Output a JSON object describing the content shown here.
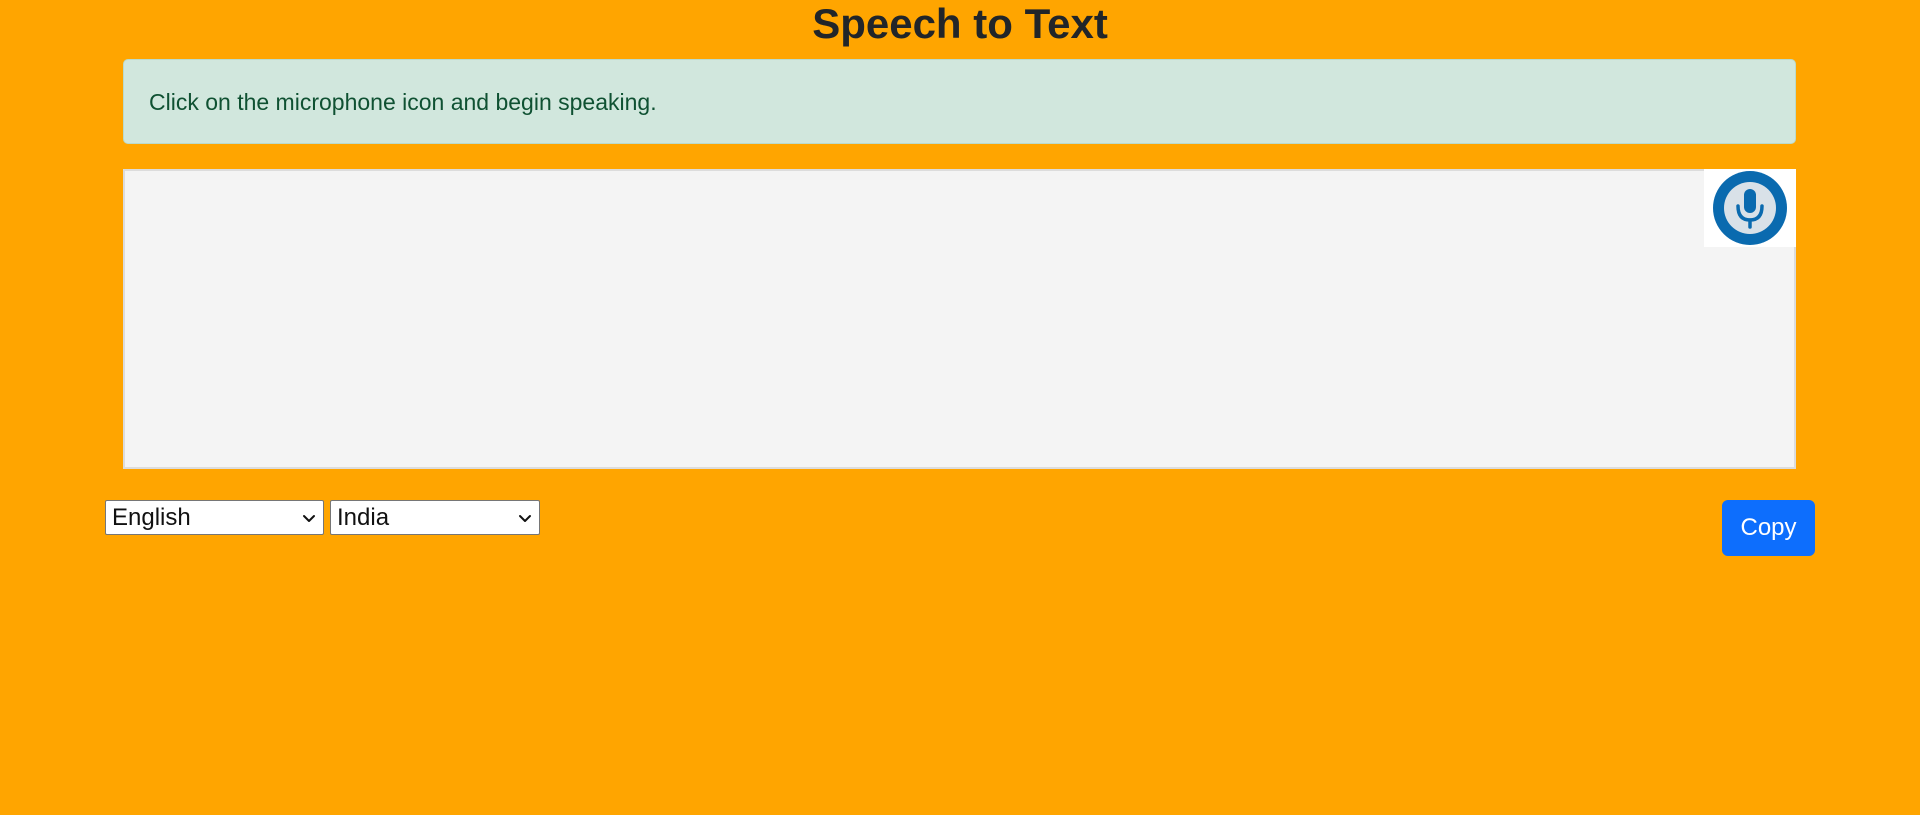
{
  "page": {
    "title": "Speech to Text"
  },
  "info": {
    "message": "Click on the microphone icon and begin speaking."
  },
  "transcript": {
    "value": "",
    "placeholder": ""
  },
  "mic": {
    "icon": "microphone-icon",
    "ring_color": "#0a6aaf",
    "inner_color": "#d9e1e8"
  },
  "language_select": {
    "selected": "English"
  },
  "region_select": {
    "selected": "India"
  },
  "copy": {
    "label": "Copy"
  },
  "colors": {
    "background": "#ffa500",
    "info_bg": "#d1e7dd",
    "button": "#0d6efd"
  }
}
